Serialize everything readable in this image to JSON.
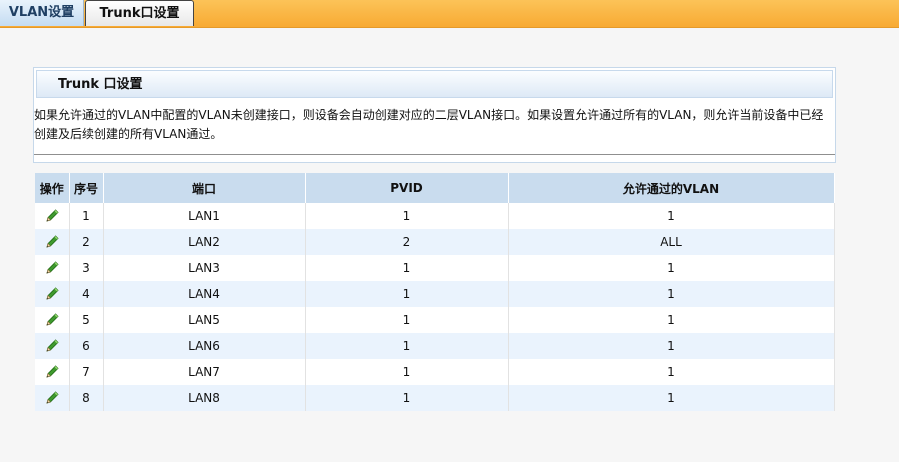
{
  "tabs": [
    {
      "label": "VLAN设置"
    },
    {
      "label": "Trunk口设置"
    }
  ],
  "panel": {
    "title": "Trunk 口设置",
    "description": "如果允许通过的VLAN中配置的VLAN未创建接口，则设备会自动创建对应的二层VLAN接口。如果设置允许通过所有的VLAN，则允许当前设备中已经创建及后续创建的所有VLAN通过。"
  },
  "table": {
    "headers": [
      "操作",
      "序号",
      "端口",
      "PVID",
      "允许通过的VLAN"
    ],
    "rows": [
      {
        "index": "1",
        "port": "LAN1",
        "pvid": "1",
        "allowed_vlan": "1"
      },
      {
        "index": "2",
        "port": "LAN2",
        "pvid": "2",
        "allowed_vlan": "ALL"
      },
      {
        "index": "3",
        "port": "LAN3",
        "pvid": "1",
        "allowed_vlan": "1"
      },
      {
        "index": "4",
        "port": "LAN4",
        "pvid": "1",
        "allowed_vlan": "1"
      },
      {
        "index": "5",
        "port": "LAN5",
        "pvid": "1",
        "allowed_vlan": "1"
      },
      {
        "index": "6",
        "port": "LAN6",
        "pvid": "1",
        "allowed_vlan": "1"
      },
      {
        "index": "7",
        "port": "LAN7",
        "pvid": "1",
        "allowed_vlan": "1"
      },
      {
        "index": "8",
        "port": "LAN8",
        "pvid": "1",
        "allowed_vlan": "1"
      }
    ],
    "row_action_icon": "edit-pencil-icon"
  },
  "colors": {
    "tabbar": "#f8aa33",
    "header_bg": "#c9dcee",
    "alt_row": "#eaf3fd"
  }
}
